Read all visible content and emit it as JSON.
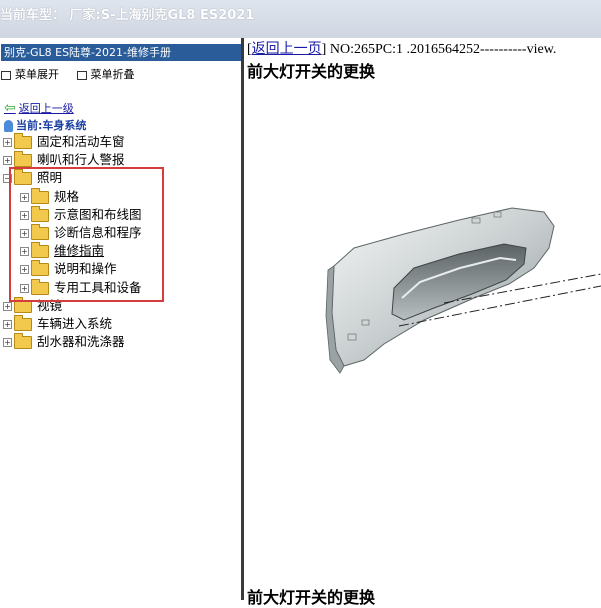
{
  "window": {
    "title": "当前车型： 厂家:S-上海别克GL8 ES2021"
  },
  "sidebar": {
    "manual_title": "别克-GL8 ES陆尊-2021-维修手册",
    "expand_label": "菜单展开",
    "collapse_label": "菜单折叠",
    "back_label": "返回上一级",
    "current_label": "当前:车身系统",
    "tree": [
      {
        "label": "固定和活动车窗",
        "level": 0,
        "state": "+"
      },
      {
        "label": "喇叭和行人警报",
        "level": 0,
        "state": "+"
      },
      {
        "label": "照明",
        "level": 0,
        "state": "-"
      },
      {
        "label": "规格",
        "level": 1,
        "state": "+"
      },
      {
        "label": "示意图和布线图",
        "level": 1,
        "state": "+"
      },
      {
        "label": "诊断信息和程序",
        "level": 1,
        "state": "+"
      },
      {
        "label": "维修指南",
        "level": 1,
        "state": "+"
      },
      {
        "label": "说明和操作",
        "level": 1,
        "state": "+"
      },
      {
        "label": "专用工具和设备",
        "level": 1,
        "state": "+"
      },
      {
        "label": "视镜",
        "level": 0,
        "state": "+"
      },
      {
        "label": "车辆进入系统",
        "level": 0,
        "state": "+"
      },
      {
        "label": "刮水器和洗涤器",
        "level": 0,
        "state": "+"
      }
    ]
  },
  "content": {
    "back_link": "返回上一页",
    "doc_info": " NO:265PC:1 .2016564252----------view.",
    "title": "前大灯开关的更换",
    "title_repeat": "前大灯开关的更换",
    "colors": {
      "highlight": "#d63c3c",
      "header_bar": "#2a5c9a",
      "link": "#1a1aa6"
    }
  }
}
